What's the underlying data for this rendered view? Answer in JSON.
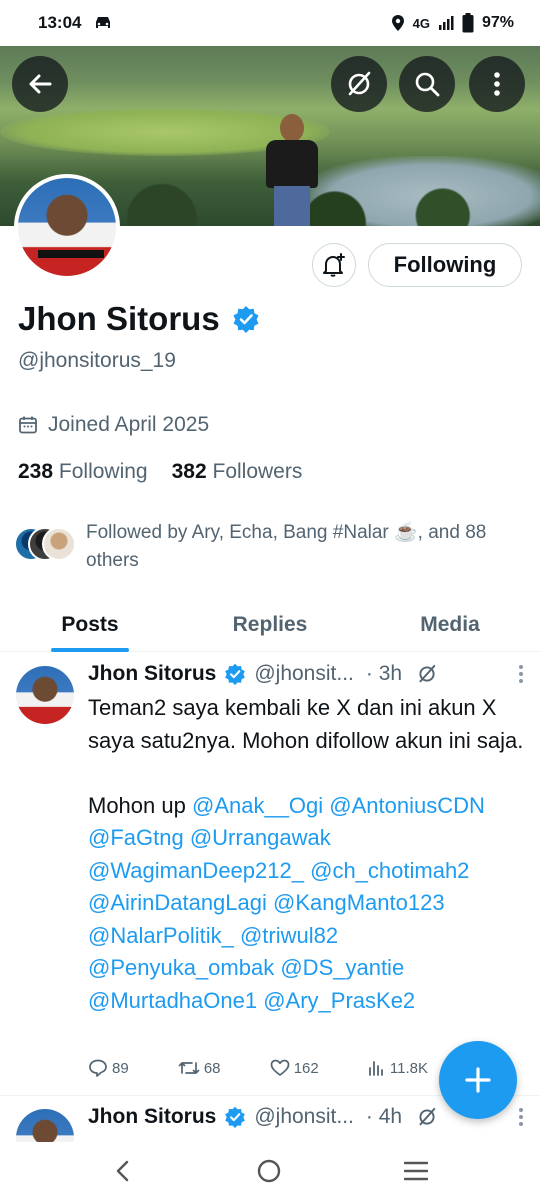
{
  "status_bar": {
    "time": "13:04",
    "network": "4G",
    "battery": "97%"
  },
  "profile": {
    "name": "Jhon Sitorus",
    "handle": "@jhonsitorus_19",
    "joined": "Joined April 2025",
    "following_count": "238",
    "following_label": "Following",
    "followers_count": "382",
    "followers_label": "Followers",
    "followed_by": "Followed by Ary, Echa, Bang #Nalar ☕️, and 88 others",
    "follow_button_label": "Following"
  },
  "tabs": [
    {
      "label": "Posts"
    },
    {
      "label": "Replies"
    },
    {
      "label": "Media"
    }
  ],
  "tweets": [
    {
      "name": "Jhon Sitorus",
      "handle": "@jhonsit...",
      "time": "· 3h",
      "text_line1": "Teman2 saya kembali ke X dan ini akun X saya satu2nya. Mohon difollow akun ini saja.",
      "text_prefix": "Mohon up",
      "mentions": [
        "@Anak__Ogi",
        "@AntoniusCDN",
        "@FaGtng",
        "@Urrangawak",
        "@WagimanDeep212_",
        "@ch_chotimah2",
        "@AirinDatangLagi",
        "@KangManto123",
        "@NalarPolitik_",
        "@triwul82",
        "@Penyuka_ombak",
        "@DS_yantie",
        "@MurtadhaOne1",
        "@Ary_PrasKe2"
      ],
      "replies": "89",
      "reposts": "68",
      "likes": "162",
      "views": "11.8K"
    },
    {
      "name": "Jhon Sitorus",
      "handle": "@jhonsit...",
      "time": "· 4h"
    }
  ],
  "colors": {
    "accent": "#1d9bf0",
    "text": "#0f1419",
    "muted": "#536471"
  }
}
